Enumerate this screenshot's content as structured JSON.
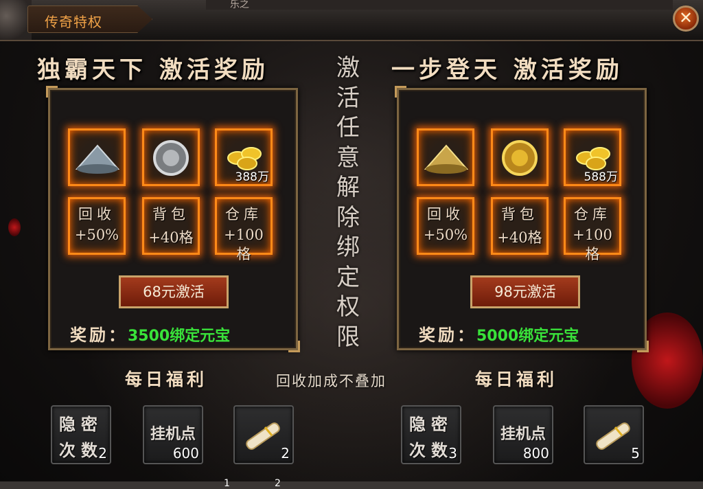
{
  "window": {
    "title": "传奇特权",
    "top_strip_text": "乐之"
  },
  "left_card": {
    "header": "独霸天下 激活奖励",
    "items": [
      {
        "icon": "bamboo-hat-silver-icon",
        "qty": ""
      },
      {
        "icon": "round-shield-silver-icon",
        "qty": ""
      },
      {
        "icon": "gold-ingots-icon",
        "qty": "388万"
      }
    ],
    "bonuses": [
      {
        "line1": "回收",
        "line2": "+50%"
      },
      {
        "line1": "背包",
        "line2": "+40格"
      },
      {
        "line1": "仓库",
        "line2": "+100格"
      }
    ],
    "button_label": "68元激活",
    "reward_label": "奖励：",
    "reward_value": "3500绑定元宝"
  },
  "right_card": {
    "header": "一步登天 激活奖励",
    "items": [
      {
        "icon": "bamboo-hat-gold-icon",
        "qty": ""
      },
      {
        "icon": "round-shield-gold-icon",
        "qty": ""
      },
      {
        "icon": "gold-ingots-icon",
        "qty": "588万"
      }
    ],
    "bonuses": [
      {
        "line1": "回收",
        "line2": "+50%"
      },
      {
        "line1": "背包",
        "line2": "+40格"
      },
      {
        "line1": "仓库",
        "line2": "+100格"
      }
    ],
    "button_label": "98元激活",
    "reward_label": "奖励：",
    "reward_value": "5000绑定元宝"
  },
  "center_vertical_text": [
    "激",
    "活",
    "任",
    "意",
    "解",
    "除",
    "绑",
    "定",
    "权",
    "限"
  ],
  "daily": {
    "left_title": "每日福利",
    "right_title": "每日福利",
    "note": "回收加成不叠加",
    "left_items": [
      {
        "l1": "隐密",
        "l2": "次数",
        "qty": "2"
      },
      {
        "l1": "挂机点",
        "qty": "600"
      },
      {
        "icon": "scroll-icon",
        "qty": "2"
      }
    ],
    "right_items": [
      {
        "l1": "隐密",
        "l2": "次数",
        "qty": "3"
      },
      {
        "l1": "挂机点",
        "qty": "800"
      },
      {
        "icon": "scroll-icon",
        "qty": "5"
      }
    ]
  },
  "pager": [
    "1",
    "2"
  ],
  "colors": {
    "accent": "#f0a247",
    "reward_green": "#39e23a",
    "glow_orange": "#ff8a18",
    "button_red": "#a33a1c"
  }
}
